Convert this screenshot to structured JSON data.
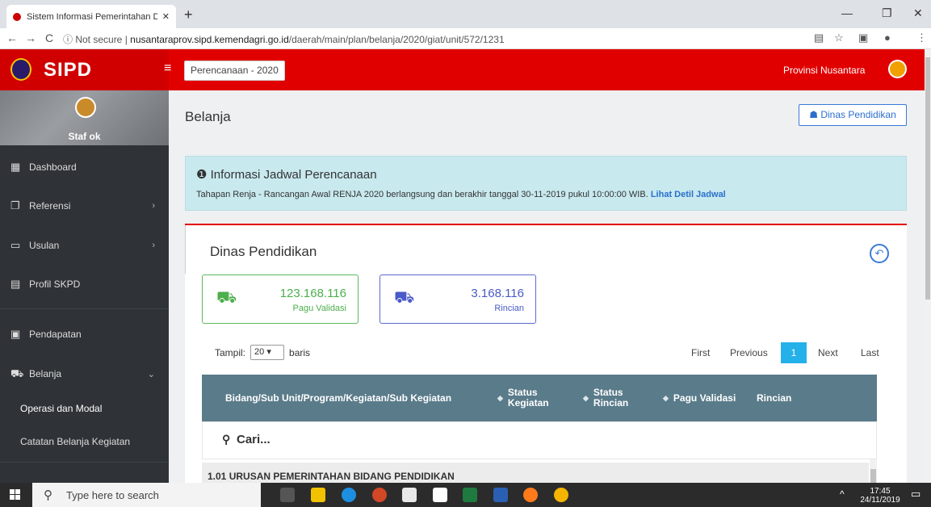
{
  "browser": {
    "tab_title": "Sistem Informasi Pemerintahan D",
    "tab_close": "✕",
    "new_tab": "+",
    "back": "←",
    "forward": "→",
    "reload": "C",
    "security": "ⓘ Not secure",
    "url_host": "nusantaraprov.sipd.kemendagri.go.id",
    "url_path": "/daerah/main/plan/belanja/2020/giat/unit/572/1231",
    "minimize": "—",
    "maximize": "❐",
    "close": "✕"
  },
  "topbar": {
    "brand": "SIPD",
    "hamburger": "≡",
    "periode": "Perencanaan - 2020",
    "province": "Provinsi Nusantara"
  },
  "sidebar": {
    "user": "Staf ok",
    "items": [
      {
        "label": "Dashboard",
        "icon": "▦"
      },
      {
        "label": "Referensi",
        "icon": "❐",
        "chev": "›"
      },
      {
        "label": "Usulan",
        "icon": "▭",
        "chev": "›"
      },
      {
        "label": "Profil SKPD",
        "icon": "▤"
      },
      {
        "label": "Pendapatan",
        "icon": "▣"
      },
      {
        "label": "Belanja",
        "icon": "⛟",
        "chev": "⌄"
      }
    ],
    "sub_items": [
      "Operasi dan Modal",
      "Catatan Belanja Kegiatan"
    ]
  },
  "main": {
    "page_title": "Belanja",
    "dinas_button": "Dinas Pendidikan",
    "alert": {
      "heading": "Informasi Jadwal Perencanaan",
      "body": "Tahapan Renja - Rancangan Awal RENJA 2020 berlangsung dan berakhir tanggal 30-11-2019 pukul 10:00:00 WIB.",
      "link": "Lihat Detil Jadwal"
    },
    "card": {
      "title": "Dinas Pendidikan",
      "stats": [
        {
          "value": "123.168.116",
          "label": "Pagu Validasi"
        },
        {
          "value": "3.168.116",
          "label": "Rincian"
        }
      ],
      "tampil_label": "Tampil:",
      "tampil_value": "20",
      "baris_label": "baris",
      "pager": [
        "First",
        "Previous",
        "1",
        "Next",
        "Last"
      ],
      "columns": [
        "Bidang/Sub Unit/Program/Kegiatan/Sub Kegiatan",
        "Status Kegiatan",
        "Status Rincian",
        "Pagu Validasi",
        "Rincian"
      ],
      "search_placeholder": "Cari...",
      "first_row": "1.01 URUSAN PEMERINTAHAN BIDANG PENDIDIKAN"
    }
  },
  "taskbar": {
    "search_placeholder": "Type here to search",
    "time": "17:45",
    "date": "24/11/2019"
  },
  "colors": {
    "brand_red": "#e10000",
    "alert_bg": "#c8e9ee",
    "table_header": "#5a7b8a",
    "stat_green": "#4cae4c",
    "stat_blue": "#4a5ac8",
    "pager_active": "#24b0e8"
  }
}
